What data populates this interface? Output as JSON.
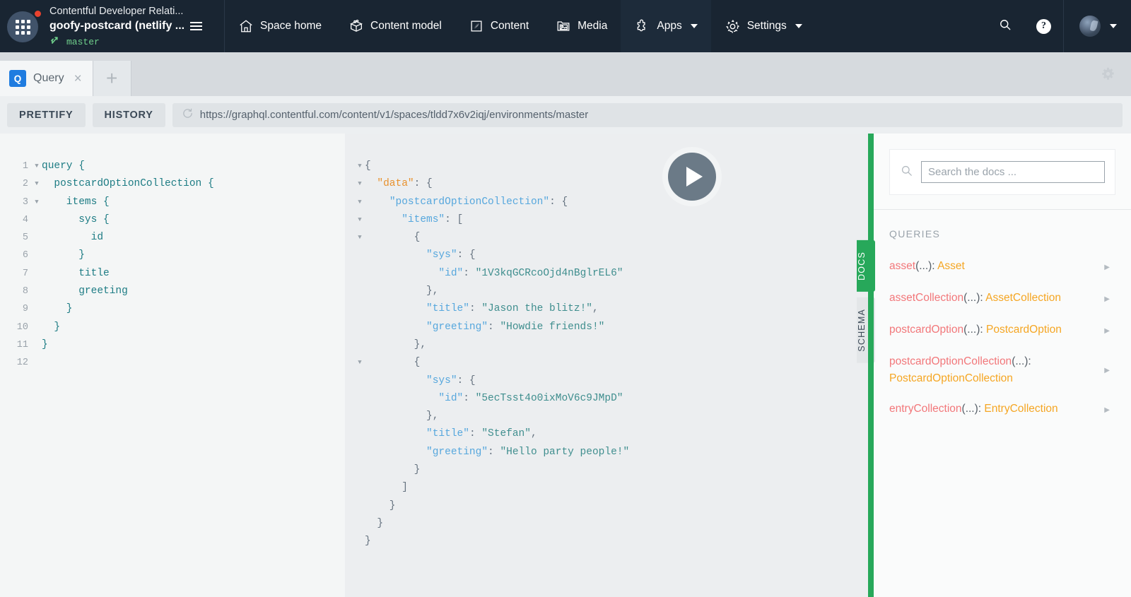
{
  "topnav": {
    "org_name": "Contentful Developer Relati...",
    "space_name": "goofy-postcard (netlify ...",
    "environment": "master",
    "items": [
      {
        "label": "Space home",
        "icon": "home-icon",
        "active": false,
        "caret": false
      },
      {
        "label": "Content model",
        "icon": "content-model-icon",
        "active": false,
        "caret": false
      },
      {
        "label": "Content",
        "icon": "content-icon",
        "active": false,
        "caret": false
      },
      {
        "label": "Media",
        "icon": "media-icon",
        "active": false,
        "caret": false
      },
      {
        "label": "Apps",
        "icon": "apps-puzzle-icon",
        "active": true,
        "caret": true
      },
      {
        "label": "Settings",
        "icon": "settings-gear-icon",
        "active": false,
        "caret": true
      }
    ],
    "colors": {
      "bar": "#192532",
      "active": "#1d2b3a",
      "env_green": "#6fcf8b",
      "badge_red": "#e8422e"
    }
  },
  "tabstrip": {
    "tab_badge": "Q",
    "tab_label": "Query",
    "close_label": "×",
    "add_label": "+"
  },
  "toolbar": {
    "prettify_label": "PRETTIFY",
    "history_label": "HISTORY",
    "url": "https://graphql.contentful.com/content/v1/spaces/tldd7x6v2iqj/environments/master"
  },
  "editor": {
    "lines": [
      {
        "n": "1",
        "fold": "▼",
        "text": "query {"
      },
      {
        "n": "2",
        "fold": "▼",
        "text": "  postcardOptionCollection {"
      },
      {
        "n": "3",
        "fold": "▼",
        "text": "    items {"
      },
      {
        "n": "4",
        "fold": "",
        "text": "      sys {"
      },
      {
        "n": "5",
        "fold": "",
        "text": "        id"
      },
      {
        "n": "6",
        "fold": "",
        "text": "      }"
      },
      {
        "n": "7",
        "fold": "",
        "text": "      title"
      },
      {
        "n": "8",
        "fold": "",
        "text": "      greeting"
      },
      {
        "n": "9",
        "fold": "",
        "text": "    }"
      },
      {
        "n": "10",
        "fold": "",
        "text": "  }"
      },
      {
        "n": "11",
        "fold": "",
        "text": "}"
      },
      {
        "n": "12",
        "fold": "",
        "text": ""
      }
    ]
  },
  "results": {
    "lines": [
      {
        "fold": "▼",
        "segs": [
          [
            "punct",
            "{"
          ]
        ]
      },
      {
        "fold": "▼",
        "segs": [
          [
            "punct",
            "  "
          ],
          [
            "orange",
            "\"data\""
          ],
          [
            "punct",
            ": {"
          ]
        ]
      },
      {
        "fold": "▼",
        "segs": [
          [
            "punct",
            "    "
          ],
          [
            "blue",
            "\"postcardOptionCollection\""
          ],
          [
            "punct",
            ": {"
          ]
        ]
      },
      {
        "fold": "▼",
        "segs": [
          [
            "punct",
            "      "
          ],
          [
            "blue",
            "\"items\""
          ],
          [
            "punct",
            ": ["
          ]
        ]
      },
      {
        "fold": "▼",
        "segs": [
          [
            "punct",
            "        {"
          ]
        ]
      },
      {
        "fold": "",
        "segs": [
          [
            "punct",
            "          "
          ],
          [
            "blue",
            "\"sys\""
          ],
          [
            "punct",
            ": {"
          ]
        ]
      },
      {
        "fold": "",
        "segs": [
          [
            "punct",
            "            "
          ],
          [
            "blue",
            "\"id\""
          ],
          [
            "punct",
            ": "
          ],
          [
            "str",
            "\"1V3kqGCRcoOjd4nBglrEL6\""
          ]
        ]
      },
      {
        "fold": "",
        "segs": [
          [
            "punct",
            "          },"
          ]
        ]
      },
      {
        "fold": "",
        "segs": [
          [
            "punct",
            "          "
          ],
          [
            "blue",
            "\"title\""
          ],
          [
            "punct",
            ": "
          ],
          [
            "str",
            "\"Jason the blitz!\""
          ],
          [
            "punct",
            ","
          ]
        ]
      },
      {
        "fold": "",
        "segs": [
          [
            "punct",
            "          "
          ],
          [
            "blue",
            "\"greeting\""
          ],
          [
            "punct",
            ": "
          ],
          [
            "str",
            "\"Howdie friends!\""
          ]
        ]
      },
      {
        "fold": "",
        "segs": [
          [
            "punct",
            "        },"
          ]
        ]
      },
      {
        "fold": "▼",
        "segs": [
          [
            "punct",
            "        {"
          ]
        ]
      },
      {
        "fold": "",
        "segs": [
          [
            "punct",
            "          "
          ],
          [
            "blue",
            "\"sys\""
          ],
          [
            "punct",
            ": {"
          ]
        ]
      },
      {
        "fold": "",
        "segs": [
          [
            "punct",
            "            "
          ],
          [
            "blue",
            "\"id\""
          ],
          [
            "punct",
            ": "
          ],
          [
            "str",
            "\"5ecTsst4o0ixMoV6c9JMpD\""
          ]
        ]
      },
      {
        "fold": "",
        "segs": [
          [
            "punct",
            "          },"
          ]
        ]
      },
      {
        "fold": "",
        "segs": [
          [
            "punct",
            "          "
          ],
          [
            "blue",
            "\"title\""
          ],
          [
            "punct",
            ": "
          ],
          [
            "str",
            "\"Stefan\""
          ],
          [
            "punct",
            ","
          ]
        ]
      },
      {
        "fold": "",
        "segs": [
          [
            "punct",
            "          "
          ],
          [
            "blue",
            "\"greeting\""
          ],
          [
            "punct",
            ": "
          ],
          [
            "str",
            "\"Hello party people!\""
          ]
        ]
      },
      {
        "fold": "",
        "segs": [
          [
            "punct",
            "        }"
          ]
        ]
      },
      {
        "fold": "",
        "segs": [
          [
            "punct",
            "      ]"
          ]
        ]
      },
      {
        "fold": "",
        "segs": [
          [
            "punct",
            "    }"
          ]
        ]
      },
      {
        "fold": "",
        "segs": [
          [
            "punct",
            "  }"
          ]
        ]
      },
      {
        "fold": "",
        "segs": [
          [
            "punct",
            "}"
          ]
        ]
      }
    ]
  },
  "docs": {
    "search_placeholder": "Search the docs ...",
    "search_value": "",
    "section_heading": "QUERIES",
    "items": [
      {
        "field": "asset",
        "args": "(...):",
        "type": "Asset"
      },
      {
        "field": "assetCollection",
        "args": "(...):",
        "type": "AssetCollection"
      },
      {
        "field": "postcardOption",
        "args": "(...):",
        "type": "PostcardOption"
      },
      {
        "field": "postcardOptionCollection",
        "args": "(...):",
        "type": "PostcardOptionCollection"
      },
      {
        "field": "entryCollection",
        "args": "(...):",
        "type": "EntryCollection"
      }
    ],
    "side_tabs": [
      {
        "label": "DOCS",
        "active": true
      },
      {
        "label": "SCHEMA",
        "active": false
      }
    ],
    "colors": {
      "divider_green": "#27a85a",
      "field": "#f2777a",
      "type": "#f5a623"
    }
  }
}
